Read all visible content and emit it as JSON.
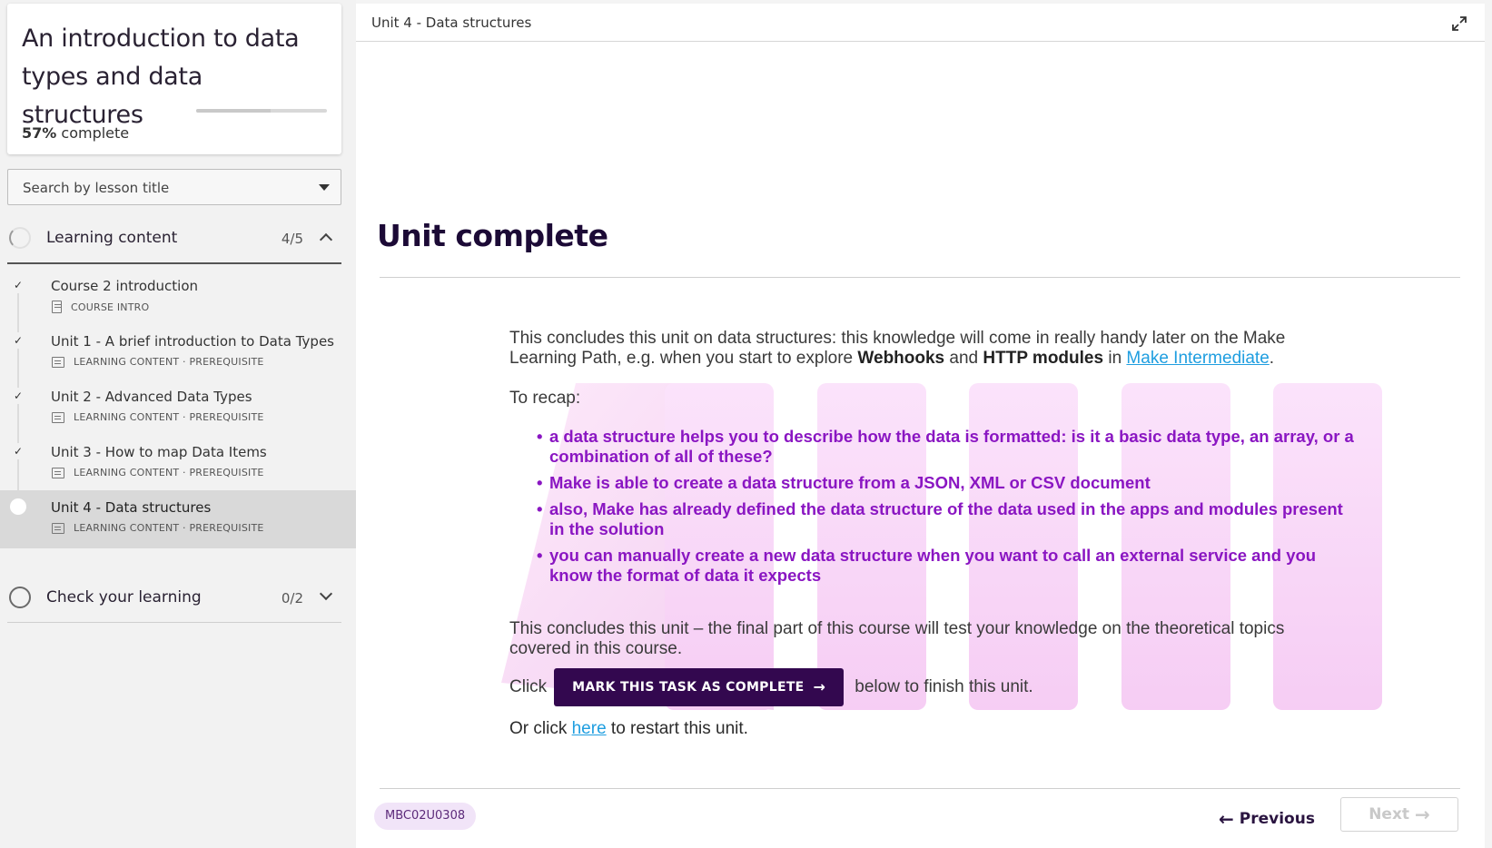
{
  "course": {
    "title": "An introduction to data types and data structures",
    "progress_percent": 57,
    "progress_value": "57%",
    "progress_suffix": "complete"
  },
  "search": {
    "placeholder": "Search by lesson title"
  },
  "sections": [
    {
      "title": "Learning content",
      "count": "4/5",
      "expanded": true
    },
    {
      "title": "Check your learning",
      "count": "0/2",
      "expanded": false
    }
  ],
  "lessons": [
    {
      "title": "Course 2 introduction",
      "meta": "COURSE INTRO",
      "icon": "document-icon",
      "completed": true
    },
    {
      "title": "Unit 1 - A brief introduction to Data Types",
      "meta": "LEARNING CONTENT · PREREQUISITE",
      "icon": "slides-icon",
      "completed": true
    },
    {
      "title": "Unit 2 - Advanced Data Types",
      "meta": "LEARNING CONTENT · PREREQUISITE",
      "icon": "slides-icon",
      "completed": true
    },
    {
      "title": "Unit 3 - How to map Data Items",
      "meta": "LEARNING CONTENT · PREREQUISITE",
      "icon": "slides-icon",
      "completed": true
    },
    {
      "title": "Unit 4 - Data structures",
      "meta": "LEARNING CONTENT · PREREQUISITE",
      "icon": "slides-icon",
      "completed": false,
      "active": true
    }
  ],
  "main": {
    "breadcrumb": "Unit 4 - Data structures",
    "heading": "Unit complete",
    "intro_pre": "This concludes this unit on data structures: this knowledge will come in really handy later on the Make Learning Path, e.g. when you start to explore ",
    "intro_bold1": "Webhooks",
    "intro_and": " and ",
    "intro_bold2": "HTTP modules",
    "intro_in": " in ",
    "intro_link": "Make Intermediate",
    "intro_end": ".",
    "recap": "To recap:",
    "bullets": [
      "a data structure helps you to describe how the data is formatted: is it a basic data type, an array, or a combination of all of these?",
      "Make is able to create a data structure from a JSON, XML or CSV document",
      "also, Make has already defined the data structure of the data used in the apps and modules present in the solution",
      "you can manually create a new data structure when you want to call an external service and you know the format of data it expects"
    ],
    "conclusion": "This concludes this unit – the final part of this course will test your knowledge on the theoretical topics covered in this course.",
    "click_pre": "Click",
    "mark_button": "MARK THIS TASK AS COMPLETE",
    "click_post": "below to finish this unit.",
    "restart_pre": "Or click ",
    "restart_link": "here",
    "restart_post": " to restart this unit."
  },
  "footer": {
    "code": "MBC02U0308",
    "previous": "Previous",
    "next": "Next"
  },
  "colors": {
    "brand_dark": "#33084f",
    "bullet_purple": "#8a16c2",
    "link": "#1f9ee0",
    "deco_pink": "#f7d6f7"
  }
}
